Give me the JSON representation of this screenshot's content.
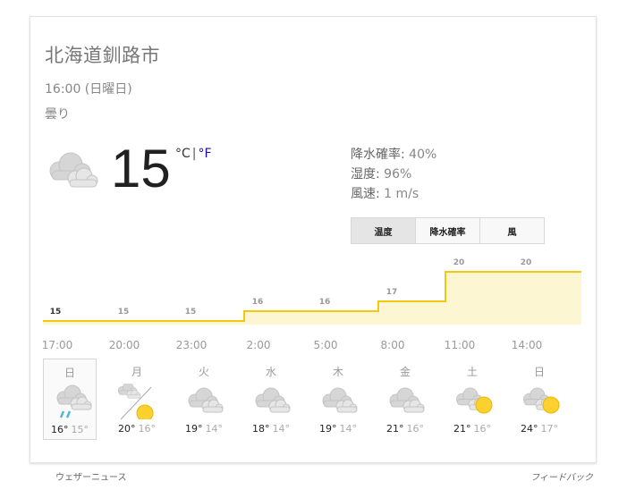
{
  "location": "北海道釧路市",
  "datetime": "16:00 (日曜日)",
  "condition": "曇り",
  "current": {
    "temp": "15",
    "unit_c": "°C",
    "separator": "|",
    "unit_f": "°F",
    "icon": "cloudy-icon"
  },
  "details": {
    "precip_label": "降水確率:",
    "precip_value": "40%",
    "humidity_label": "湿度:",
    "humidity_value": "96%",
    "wind_label": "風速:",
    "wind_value": "1 m/s"
  },
  "tabs": [
    {
      "label": "温度",
      "active": true
    },
    {
      "label": "降水確率",
      "active": false
    },
    {
      "label": "風",
      "active": false
    }
  ],
  "chart_data": {
    "type": "area",
    "x": [
      "17:00",
      "20:00",
      "23:00",
      "2:00",
      "5:00",
      "8:00",
      "11:00",
      "14:00"
    ],
    "values": [
      15,
      15,
      15,
      16,
      16,
      17,
      20,
      20
    ],
    "value_labels": [
      "15",
      "15",
      "15",
      "16",
      "16",
      "17",
      "20",
      "20"
    ],
    "colors": {
      "line": "#f2c811",
      "fill": "#fdf6d3"
    }
  },
  "days": [
    {
      "name": "日",
      "hi": "16°",
      "lo": "15°",
      "icon": "rain-cloud-icon",
      "active": true
    },
    {
      "name": "月",
      "hi": "20°",
      "lo": "16°",
      "icon": "partly-sunny-icon",
      "active": false
    },
    {
      "name": "火",
      "hi": "19°",
      "lo": "14°",
      "icon": "cloudy-icon",
      "active": false
    },
    {
      "name": "水",
      "hi": "18°",
      "lo": "14°",
      "icon": "cloudy-icon",
      "active": false
    },
    {
      "name": "木",
      "hi": "19°",
      "lo": "14°",
      "icon": "cloudy-icon",
      "active": false
    },
    {
      "name": "金",
      "hi": "21°",
      "lo": "16°",
      "icon": "cloudy-icon",
      "active": false
    },
    {
      "name": "土",
      "hi": "21°",
      "lo": "16°",
      "icon": "sun-behind-cloud-icon",
      "active": false
    },
    {
      "name": "日",
      "hi": "24°",
      "lo": "17°",
      "icon": "sun-behind-cloud-icon",
      "active": false
    }
  ],
  "footer": {
    "source": "ウェザーニュース",
    "feedback": "フィードバック"
  }
}
